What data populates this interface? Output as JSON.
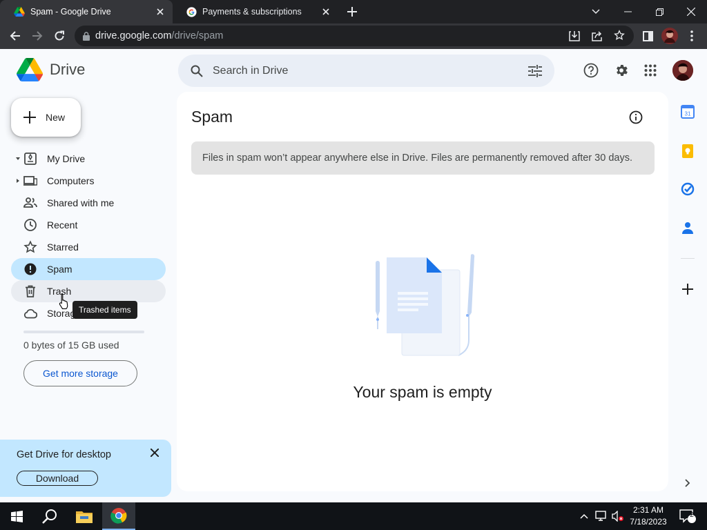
{
  "browser": {
    "tabs": [
      {
        "title": "Spam - Google Drive",
        "active": true,
        "icon": "google-drive-icon"
      },
      {
        "title": "Payments & subscriptions",
        "active": false,
        "icon": "google-g-icon"
      }
    ],
    "url_host": "drive.google.com",
    "url_path": "/drive/spam"
  },
  "drive": {
    "app_name": "Drive",
    "search_placeholder": "Search in Drive",
    "new_label": "New",
    "nav": [
      {
        "label": "My Drive",
        "icon": "my-drive-icon"
      },
      {
        "label": "Computers",
        "icon": "computer-icon"
      },
      {
        "label": "Shared with me",
        "icon": "people-icon"
      },
      {
        "label": "Recent",
        "icon": "clock-icon"
      },
      {
        "label": "Starred",
        "icon": "star-icon"
      },
      {
        "label": "Spam",
        "icon": "spam-icon",
        "active": true
      },
      {
        "label": "Trash",
        "icon": "trash-icon"
      },
      {
        "label": "Storage",
        "icon": "cloud-icon"
      }
    ],
    "tooltip": "Trashed items",
    "storage_used": 0,
    "storage_text": "0 bytes of 15 GB used",
    "get_storage": "Get more storage",
    "promo_title": "Get Drive for desktop",
    "promo_button": "Download",
    "page_title": "Spam",
    "banner": "Files in spam won’t appear anywhere else in Drive. Files are permanently removed after 30 days.",
    "empty_text": "Your spam is empty"
  },
  "colors": {
    "active_nav": "#c2e7ff",
    "accent": "#0b57d0",
    "background": "#f8fafd"
  },
  "taskbar": {
    "time": "2:31 AM",
    "date": "7/18/2023",
    "notification_count": "2"
  }
}
